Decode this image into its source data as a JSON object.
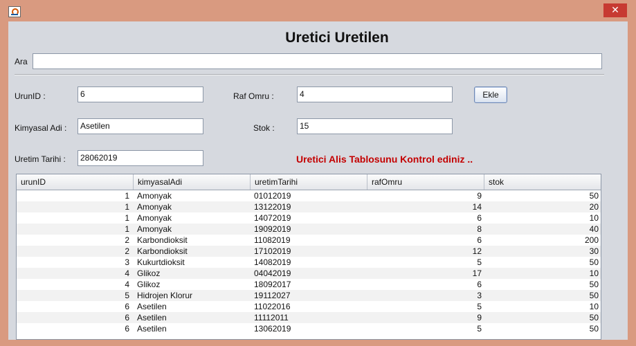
{
  "window": {
    "close_glyph": "✕"
  },
  "title": "Uretici Uretilen",
  "search": {
    "label": "Ara",
    "value": ""
  },
  "form": {
    "urunid_label": "UrunID :",
    "urunid_value": "6",
    "rafomru_label": "Raf Omru :",
    "rafomru_value": "4",
    "kimyasal_label": "Kimyasal Adi :",
    "kimyasal_value": "Asetilen",
    "stok_label": "Stok :",
    "stok_value": "15",
    "uretim_label": "Uretim Tarihi :",
    "uretim_value": "28062019",
    "ekle_label": "Ekle"
  },
  "warning": "Uretici Alis Tablosunu Kontrol ediniz ..",
  "table": {
    "headers": [
      "urunID",
      "kimyasalAdi",
      "uretimTarihi",
      "rafOmru",
      "stok"
    ],
    "rows": [
      [
        "1",
        "Amonyak",
        "01012019",
        "9",
        "50"
      ],
      [
        "1",
        "Amonyak",
        "13122019",
        "14",
        "20"
      ],
      [
        "1",
        "Amonyak",
        "14072019",
        "6",
        "10"
      ],
      [
        "1",
        "Amonyak",
        "19092019",
        "8",
        "40"
      ],
      [
        "2",
        "Karbondioksit",
        "11082019",
        "6",
        "200"
      ],
      [
        "2",
        "Karbondioksit",
        "17102019",
        "12",
        "30"
      ],
      [
        "3",
        "Kukurtdioksit",
        "14082019",
        "5",
        "50"
      ],
      [
        "4",
        "Glikoz",
        "04042019",
        "17",
        "10"
      ],
      [
        "4",
        "Glikoz",
        "18092017",
        "6",
        "50"
      ],
      [
        "5",
        "Hidrojen Klorur",
        "19112027",
        "3",
        "50"
      ],
      [
        "6",
        "Asetilen",
        "11022016",
        "5",
        "10"
      ],
      [
        "6",
        "Asetilen",
        "11112011",
        "9",
        "50"
      ],
      [
        "6",
        "Asetilen",
        "13062019",
        "5",
        "50"
      ]
    ]
  }
}
